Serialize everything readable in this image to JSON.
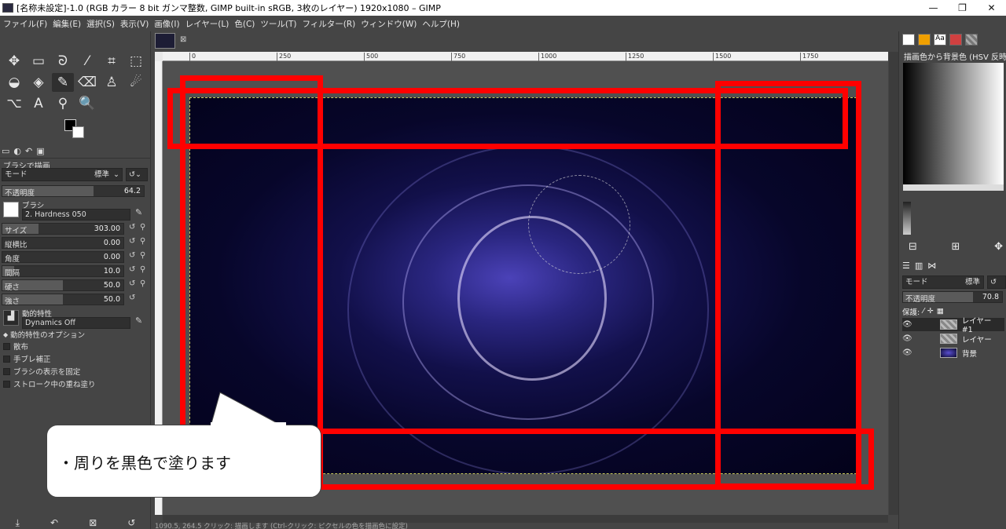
{
  "window": {
    "title": "[名称未設定]-1.0 (RGB カラー 8 bit ガンマ整数, GIMP built-in sRGB, 3枚のレイヤー) 1920x1080 – GIMP",
    "minimize": "—",
    "maximize": "❐",
    "close": "✕"
  },
  "menubar": [
    "ファイル(F)",
    "編集(E)",
    "選択(S)",
    "表示(V)",
    "画像(I)",
    "レイヤー(L)",
    "色(C)",
    "ツール(T)",
    "フィルター(R)",
    "ウィンドウ(W)",
    "ヘルプ(H)"
  ],
  "tools": [
    {
      "name": "move-tool-icon",
      "glyph": "✥"
    },
    {
      "name": "rect-select-icon",
      "glyph": "▭"
    },
    {
      "name": "lasso-icon",
      "glyph": "ᘐ"
    },
    {
      "name": "fuzzy-select-icon",
      "glyph": "⁄"
    },
    {
      "name": "crop-icon",
      "glyph": "⌗"
    },
    {
      "name": "transform-icon",
      "glyph": "⬚"
    },
    {
      "name": "warp-icon",
      "glyph": "◒"
    },
    {
      "name": "bucket-fill-icon",
      "glyph": "◈"
    },
    {
      "name": "paintbrush-icon",
      "glyph": "✎",
      "active": true
    },
    {
      "name": "eraser-icon",
      "glyph": "⌫"
    },
    {
      "name": "clone-icon",
      "glyph": "♙"
    },
    {
      "name": "smudge-icon",
      "glyph": "☄"
    },
    {
      "name": "paths-icon",
      "glyph": "⌥"
    },
    {
      "name": "text-tool-icon",
      "glyph": "A"
    },
    {
      "name": "color-picker-icon",
      "glyph": "⚲"
    },
    {
      "name": "zoom-icon",
      "glyph": "🔍"
    }
  ],
  "tool_options": {
    "title": "ブラシで描画",
    "mode_label": "モード",
    "mode_value": "標準",
    "opacity_label": "不透明度",
    "opacity_value": "64.2",
    "opacity_fraction": 0.642,
    "brush_label": "ブラシ",
    "brush_value": "2. Hardness 050",
    "sliders": [
      {
        "label": "サイズ",
        "value": "303.00",
        "fraction": 0.3
      },
      {
        "label": "縦横比",
        "value": "0.00",
        "fraction": 0.0
      },
      {
        "label": "角度",
        "value": "0.00",
        "fraction": 0.0
      },
      {
        "label": "間隔",
        "value": "10.0",
        "fraction": 0.1
      },
      {
        "label": "硬さ",
        "value": "50.0",
        "fraction": 0.5
      },
      {
        "label": "強さ",
        "value": "50.0",
        "fraction": 0.5
      }
    ],
    "dynamics_label": "動的特性",
    "dynamics_value": "Dynamics Off",
    "checks": [
      "動的特性のオプション",
      "散布",
      "手ブレ補正",
      "ブラシの表示を固定",
      "ストローク中の重ね塗り"
    ]
  },
  "canvas": {
    "ruler_ticks": [
      "0",
      "250",
      "500",
      "750",
      "1000",
      "1250",
      "1500",
      "1750"
    ],
    "status_text": "1090.5, 264.5    クリック: 描画します (Ctrl-クリック: ピクセルの色を描画色に設定)"
  },
  "right_dock": {
    "gradient_title": "描画色から背景色 (HSV 反時計",
    "layers_mode_label": "モード",
    "layers_mode_value": "標準",
    "layers_opacity_label": "不透明度",
    "layers_opacity_value": "70.8",
    "lock_label": "保護:",
    "layers": [
      {
        "name": "レイヤー #1",
        "selected": true
      },
      {
        "name": "レイヤー",
        "selected": false
      },
      {
        "name": "背景",
        "selected": false
      }
    ]
  },
  "annotation": {
    "callout_text": "・周りを黒色で塗ります",
    "highlight_color": "#ff0000"
  }
}
